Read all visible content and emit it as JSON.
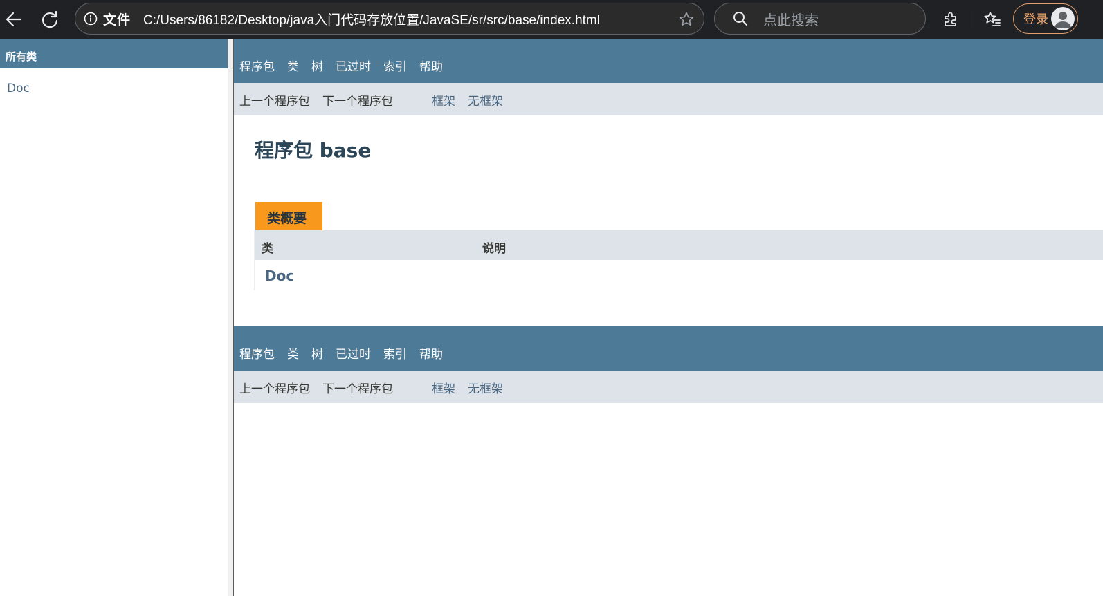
{
  "browser": {
    "file_label": "文件",
    "url": "C:/Users/86182/Desktop/java入门代码存放位置/JavaSE/sr/src/base/index.html",
    "search_placeholder": "点此搜索",
    "login_label": "登录",
    "icons": [
      "back-arrow-icon",
      "reload-icon",
      "info-icon",
      "star-icon",
      "search-icon",
      "extensions-icon",
      "favorites-icon",
      "user-avatar-icon"
    ]
  },
  "left_frame": {
    "header": "所有类",
    "classes": [
      "Doc"
    ]
  },
  "nav": {
    "items": [
      "程序包",
      "类",
      "树",
      "已过时",
      "索引",
      "帮助"
    ],
    "prev_package": "上一个程序包",
    "next_package": "下一个程序包",
    "frames": "框架",
    "no_frames": "无框架"
  },
  "main": {
    "title": "程序包 base",
    "summary_tab": "类概要",
    "table": {
      "headers": [
        "类",
        "说明"
      ],
      "rows": [
        {
          "class": "Doc",
          "description": ""
        }
      ]
    }
  },
  "colors": {
    "nav_bar": "#4d7a97",
    "sub_nav": "#dee3e9",
    "tab_accent": "#f8981d",
    "link": "#4a6782",
    "browser_chrome": "#202124"
  }
}
